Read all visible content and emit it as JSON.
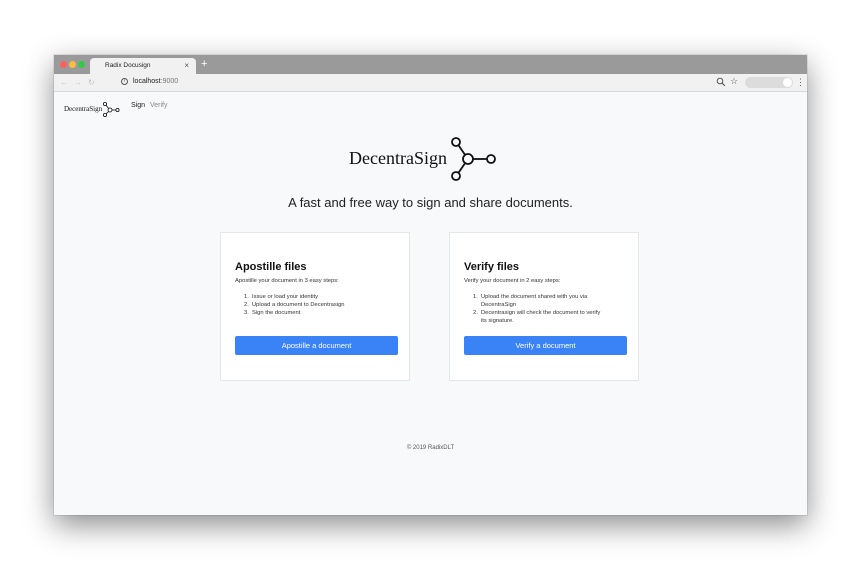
{
  "browser": {
    "tab_title": "Radix Docusign",
    "tab_close": "×",
    "new_tab": "+",
    "url_host": "localhost",
    "url_port": ":9000"
  },
  "app_nav": {
    "brand": "DecentraSign",
    "links": [
      {
        "label": "Sign",
        "active": true
      },
      {
        "label": "Verify",
        "active": false
      }
    ]
  },
  "hero": {
    "brand": "DecentraSign",
    "tagline": "A fast and free way to sign and share documents."
  },
  "cards": [
    {
      "title": "Apostille files",
      "description": "Apostille your document in 3 easy steps:",
      "steps": [
        {
          "num": "1.",
          "text": "Issue or load your identity"
        },
        {
          "num": "2.",
          "text": "Upload a document to Decentrasign"
        },
        {
          "num": "3.",
          "text": "Sign the document"
        }
      ],
      "button": "Apostille a document"
    },
    {
      "title": "Verify files",
      "description": "Verify your document in 2 easy steps:",
      "steps": [
        {
          "num": "1.",
          "text": "Upload the document shared with you via"
        },
        {
          "num": "",
          "text": "DecentraSign"
        },
        {
          "num": "2.",
          "text": "Decentrasign will check the document to verify"
        },
        {
          "num": "",
          "text": "its signature."
        }
      ],
      "button": "Verify a document"
    }
  ],
  "footer": {
    "text": "© 2019 RadixDLT"
  },
  "colors": {
    "primary_button": "#3a83f7",
    "page_background": "#f8f9fb"
  },
  "icons": {
    "logo": "node-graph-icon"
  }
}
